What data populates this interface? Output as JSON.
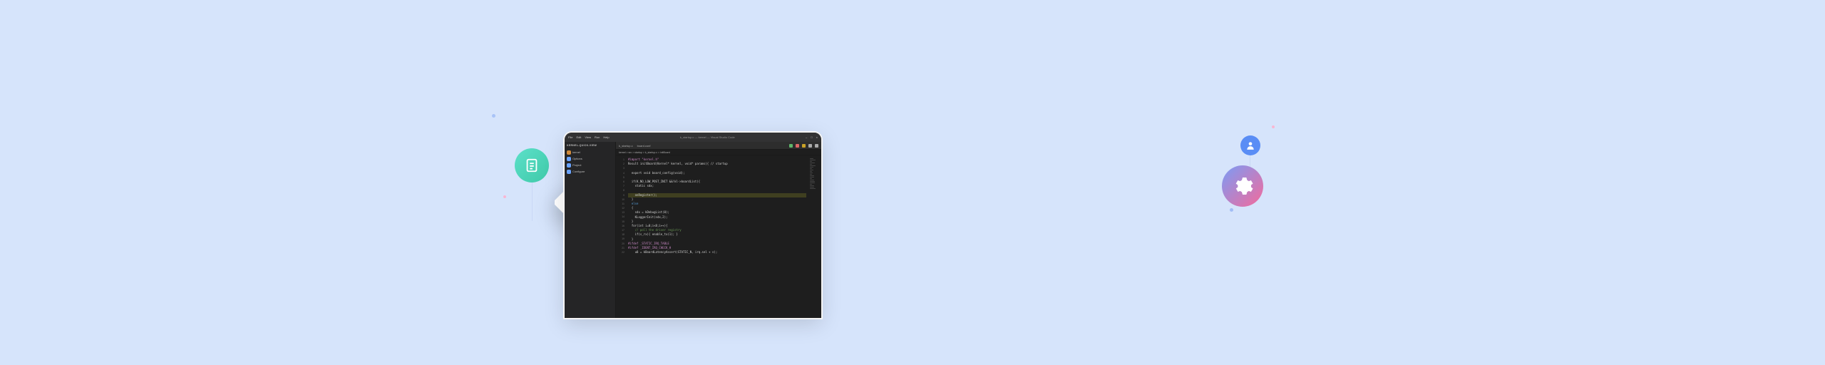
{
  "left_icons": {
    "document": "document-icon",
    "code": "code-icon"
  },
  "right_icons": {
    "user": "user-icon",
    "gear": "gear-icon"
  },
  "ide": {
    "titlebar": {
      "menus": [
        "File",
        "Edit",
        "View",
        "Run",
        "Help"
      ],
      "center": "k_startup.c — kernel — Visual Studio Code",
      "right_controls": [
        "min-icon",
        "max-icon",
        "close-icon"
      ]
    },
    "sidebar": {
      "title": "KERNEL-QUICK-VIEW",
      "items": [
        {
          "icon": "folder-icon",
          "color": "#d08a3a",
          "label": "kernel"
        },
        {
          "icon": "gear-icon",
          "color": "#6aa3ff",
          "label": "Options"
        },
        {
          "icon": "info-icon",
          "color": "#6aa3ff",
          "label": "Project"
        },
        {
          "icon": "gear-icon",
          "color": "#6aa3ff",
          "label": "Configure"
        }
      ]
    },
    "tabbar": {
      "left": [
        {
          "icon": "file-icon",
          "label": "k_startup.c"
        },
        {
          "icon": "file-icon",
          "label": "board.conf"
        }
      ],
      "right": [
        {
          "icon": "play-icon",
          "color": "#5fb56a"
        },
        {
          "icon": "bug-icon",
          "color": "#d66"
        },
        {
          "icon": "stop-icon",
          "color": "#c9a227"
        },
        {
          "icon": "down-icon",
          "color": "#aaa"
        },
        {
          "icon": "more-icon",
          "color": "#aaa"
        }
      ],
      "breadcrumb": "kernel > src > startup > k_startup.c > initBoard"
    },
    "code": {
      "start_line": 1,
      "lines": [
        {
          "t": "#import \"kernel.h\"",
          "cls": "pp"
        },
        {
          "t": "Result initBoard(Kernel* kernel, void* params){ // startup",
          "cls": ""
        },
        {
          "t": "",
          "cls": ""
        },
        {
          "t": "  export void board_config(void);",
          "cls": ""
        },
        {
          "t": "",
          "cls": ""
        },
        {
          "t": "  if(K_NO_LOW_POST_INIT &&!kl->boardList){",
          "cls": ""
        },
        {
          "t": "    static sdx;",
          "cls": ""
        },
        {
          "t": "",
          "cls": ""
        },
        {
          "t": "    onRegister();",
          "cls": "",
          "hl": true
        },
        {
          "t": "  }",
          "cls": ""
        },
        {
          "t": "  else",
          "cls": "kw"
        },
        {
          "t": "  {",
          "cls": ""
        },
        {
          "t": "    sdx = kDebugList(0);",
          "cls": ""
        },
        {
          "t": "    KLoggerInit(sdx,2);",
          "cls": ""
        },
        {
          "t": "  }",
          "cls": ""
        },
        {
          "t": "  for(int i=0;i<8;i++){",
          "cls": ""
        },
        {
          "t": "    // poll the driver registry",
          "cls": "cm"
        },
        {
          "t": "    if(s_rx){ enable_tx(1); }",
          "cls": ""
        },
        {
          "t": "  }",
          "cls": ""
        },
        {
          "t": "#ifdef _STATIC_IRQ_TABLE",
          "cls": "pp"
        },
        {
          "t": "#ifdef _IDENT_IRQ_CHECK_H",
          "cls": "pp"
        },
        {
          "t": "    u8 = kBoardLatencyAssert(STATIC_N, irq.sel + s);",
          "cls": ""
        }
      ]
    }
  }
}
